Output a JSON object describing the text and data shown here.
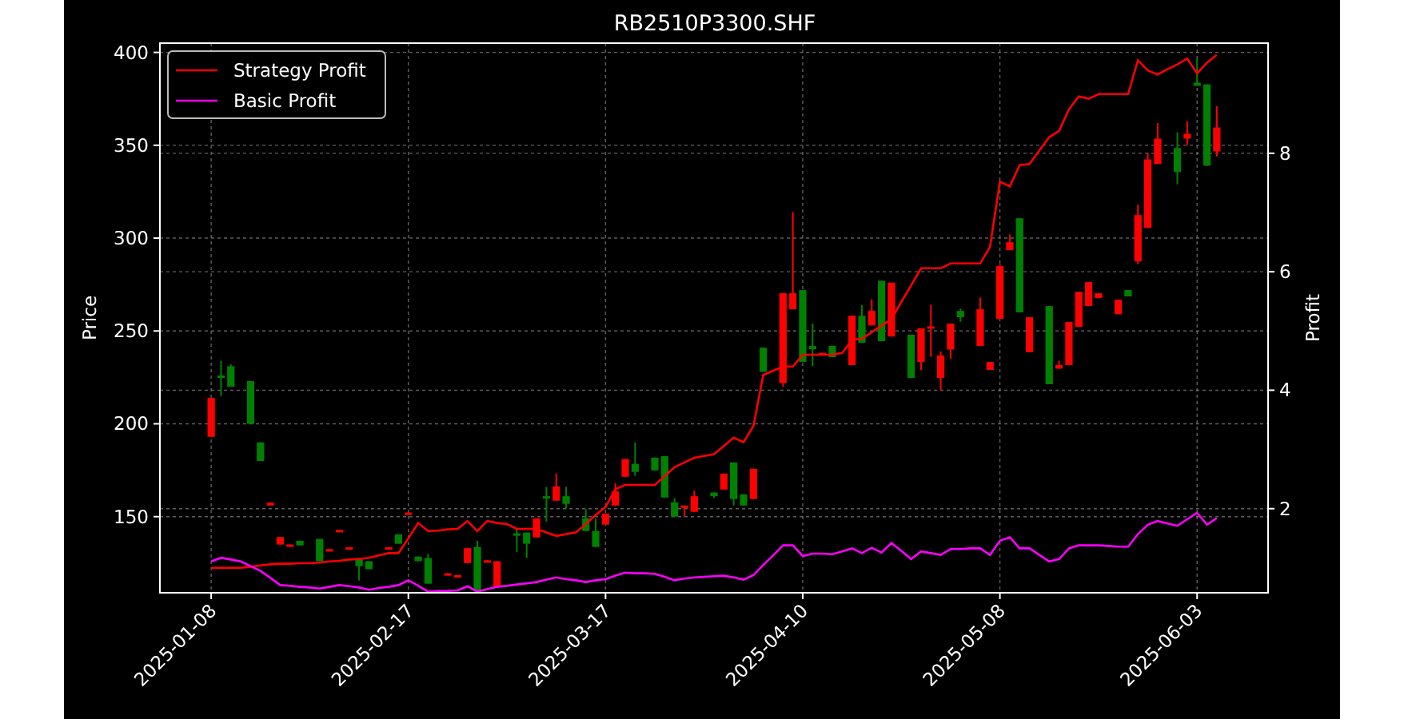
{
  "price_chart": {
    "chart_data": {
      "type": "candlestick",
      "title": "RB2510P3300.SHF",
      "ylabel": "Price",
      "grid": true,
      "ylim": [
        109,
        405
      ],
      "categories": [
        "2025-01-08",
        null,
        null,
        null,
        null,
        null,
        null,
        null,
        null,
        null,
        null,
        null,
        null,
        null,
        null,
        null,
        null,
        null,
        null,
        null,
        "2025-02-17",
        null,
        null,
        null,
        null,
        null,
        null,
        null,
        null,
        null,
        null,
        null,
        null,
        null,
        null,
        null,
        null,
        null,
        null,
        null,
        "2025-03-17",
        null,
        null,
        null,
        null,
        null,
        null,
        null,
        null,
        null,
        null,
        null,
        null,
        null,
        null,
        null,
        null,
        null,
        null,
        null,
        "2025-04-10",
        null,
        null,
        null,
        null,
        null,
        null,
        null,
        null,
        null,
        null,
        null,
        null,
        null,
        null,
        null,
        null,
        null,
        null,
        null,
        "2025-05-08",
        null,
        null,
        null,
        null,
        null,
        null,
        null,
        null,
        null,
        null,
        null,
        null,
        null,
        null,
        null,
        null,
        null,
        null,
        null,
        "2025-06-03",
        null,
        null
      ],
      "yticks": [
        {
          "value": 150,
          "label": "150"
        },
        {
          "value": 200,
          "label": "200"
        },
        {
          "value": 250,
          "label": "250"
        },
        {
          "value": 300,
          "label": "300"
        },
        {
          "value": 350,
          "label": "350"
        },
        {
          "value": 400,
          "label": "400"
        }
      ],
      "ohlc": [
        [
          193,
          214,
          193,
          214
        ],
        [
          226,
          234,
          215,
          225
        ],
        [
          231,
          232,
          220,
          220
        ],
        null,
        [
          223,
          223,
          200,
          200
        ],
        [
          190,
          190,
          180,
          180
        ],
        [
          156,
          157.5,
          156,
          157.5
        ],
        [
          135,
          139,
          135,
          139
        ],
        [
          134,
          135,
          134,
          135
        ],
        [
          137,
          137,
          134.5,
          134.5
        ],
        null,
        [
          138,
          138,
          126,
          126
        ],
        [
          131.5,
          132.5,
          131.5,
          132.5
        ],
        [
          141.8,
          142.8,
          141.8,
          142.8
        ],
        [
          132.5,
          133.5,
          132.5,
          133.5
        ],
        [
          127.7,
          127.7,
          115.6,
          123.4
        ],
        [
          126,
          126,
          121.7,
          121.7
        ],
        null,
        [
          132.5,
          133.5,
          132.5,
          133.5
        ],
        [
          140.5,
          140.5,
          135.4,
          135.4
        ],
        [
          151.2,
          152.2,
          151.2,
          152.2
        ],
        [
          128.5,
          128.5,
          126,
          126
        ],
        [
          127.7,
          130,
          113.9,
          113.9
        ],
        null,
        [
          118.5,
          119.5,
          118.5,
          119.5
        ],
        [
          117.5,
          118.5,
          117.5,
          118.5
        ],
        [
          125,
          133,
          125,
          133
        ],
        [
          133.7,
          137,
          109.6,
          109.6
        ],
        [
          125.5,
          126.5,
          125.5,
          126.5
        ],
        [
          112.2,
          126,
          112.2,
          126
        ],
        null,
        [
          141,
          143.8,
          131,
          140
        ],
        [
          141.4,
          141.4,
          127.7,
          135.4
        ],
        [
          138.8,
          149.1,
          138.8,
          149.1
        ],
        [
          161,
          166,
          147.4,
          160
        ],
        [
          158.6,
          173.2,
          158.6,
          166.3
        ],
        [
          161,
          166,
          154.3,
          156.9
        ],
        null,
        [
          149.1,
          154,
          142.3,
          142.3
        ],
        [
          142.3,
          149,
          133.7,
          133.7
        ],
        [
          145.7,
          151.7,
          145.7,
          151.7
        ],
        [
          156,
          168,
          156,
          163.7
        ],
        [
          171.5,
          181,
          171.5,
          181
        ],
        [
          178.4,
          190,
          172,
          174.1
        ],
        null,
        [
          181.8,
          181.8,
          174.9,
          174.9
        ],
        [
          182.6,
          182.6,
          160.3,
          160.3
        ],
        [
          157.7,
          160,
          150,
          150
        ],
        [
          155,
          156,
          150,
          156
        ],
        [
          152.6,
          164,
          152.6,
          161
        ],
        null,
        [
          163,
          163,
          160,
          161
        ],
        [
          164.6,
          173.2,
          164.6,
          173.2
        ],
        [
          179.2,
          179.2,
          156,
          159.5
        ],
        [
          162,
          162,
          156,
          156
        ],
        [
          159.5,
          175.8,
          159.5,
          175.8
        ],
        [
          241,
          241,
          228,
          228
        ],
        null,
        [
          222,
          270.3,
          220,
          270.3
        ],
        [
          261.7,
          314,
          261.7,
          270.3
        ],
        [
          272,
          272,
          233.3,
          233.3
        ],
        [
          241.9,
          254,
          231,
          240.2
        ],
        [
          237,
          238.2,
          237,
          238.2
        ],
        [
          242,
          242,
          235.9,
          235.9
        ],
        null,
        [
          231.6,
          258.2,
          231.6,
          258.2
        ],
        [
          258.2,
          264,
          243.6,
          243.6
        ],
        [
          253,
          267,
          253,
          260.8
        ],
        [
          277,
          277,
          244.5,
          244.5
        ],
        [
          247,
          276,
          247,
          276
        ],
        null,
        [
          248,
          248,
          224.7,
          224.7
        ],
        [
          233.3,
          251.4,
          229,
          251.4
        ],
        [
          251.5,
          264,
          236,
          252.5
        ],
        [
          224.7,
          239,
          218,
          236.8
        ],
        [
          240,
          254,
          235,
          254
        ],
        [
          260.8,
          262,
          255,
          257.4
        ],
        null,
        [
          241.9,
          268,
          241.9,
          261.7
        ],
        [
          229,
          233.3,
          229,
          233.3
        ],
        [
          256.5,
          286,
          256.5,
          284.9
        ],
        [
          293.5,
          302,
          293.5,
          297.8
        ],
        [
          310.7,
          310.7,
          260,
          260
        ],
        [
          238.5,
          257.4,
          238.5,
          257.4
        ],
        null,
        [
          263.4,
          263.4,
          221.3,
          221.3
        ],
        [
          229.7,
          234,
          229.7,
          231.6
        ],
        [
          231.6,
          254.8,
          231.6,
          254.8
        ],
        [
          252.2,
          271.1,
          252.2,
          271.1
        ],
        [
          263.4,
          276.3,
          263.4,
          276.3
        ],
        [
          267.7,
          270.3,
          267.7,
          270.3
        ],
        null,
        [
          259,
          266.8,
          259,
          266.8
        ],
        [
          272,
          272,
          268.6,
          268.6
        ],
        [
          287.5,
          318,
          286,
          312.4
        ],
        [
          305.5,
          346,
          305.5,
          342.4
        ],
        [
          339.9,
          362,
          339.9,
          353.6
        ],
        null,
        [
          348.5,
          357,
          329,
          335.6
        ],
        [
          353.6,
          363,
          350,
          356.2
        ],
        [
          383.7,
          397,
          382,
          382
        ],
        [
          382.8,
          382.8,
          339,
          339
        ],
        [
          346.7,
          371,
          344,
          359.6
        ]
      ]
    }
  },
  "profit_chart": {
    "chart_data": {
      "type": "line",
      "ylabel": "Profit",
      "legend": "upper left",
      "ylim": [
        0.58,
        9.86
      ],
      "categories": [
        null,
        null,
        null,
        null,
        null,
        null,
        null,
        null,
        null,
        null,
        null,
        null,
        null,
        null,
        null,
        null,
        null,
        null,
        null,
        null,
        null,
        null,
        null,
        null,
        null,
        null,
        null,
        null,
        null,
        null,
        null,
        null,
        null,
        null,
        null,
        null,
        null,
        null,
        null,
        null,
        null,
        null,
        null,
        null,
        null,
        null,
        null,
        null,
        null,
        null,
        null,
        null,
        null,
        null,
        null,
        null,
        null,
        null,
        null,
        null,
        null,
        null,
        null,
        null,
        null,
        null,
        null,
        null,
        null,
        null,
        null,
        null,
        null,
        null,
        null,
        null,
        null,
        null,
        null,
        null,
        null,
        null,
        null,
        null,
        null,
        null,
        null,
        null,
        null,
        null,
        null,
        null,
        null,
        null,
        null,
        null,
        null,
        null,
        null,
        null,
        null,
        null,
        null
      ],
      "yticks": [
        {
          "value": 2,
          "label": "2"
        },
        {
          "value": 4,
          "label": "4"
        },
        {
          "value": 6,
          "label": "6"
        },
        {
          "value": 8,
          "label": "8"
        }
      ],
      "series": [
        {
          "name": "Strategy Profit",
          "color": "#ff0000",
          "values": [
            1.0,
            1.0,
            1.0,
            1.0,
            1.02,
            1.04,
            1.06,
            1.07,
            1.07,
            1.08,
            1.08,
            1.09,
            1.11,
            1.12,
            1.14,
            1.15,
            1.17,
            1.21,
            1.25,
            1.25,
            1.5,
            1.76,
            1.62,
            1.63,
            1.65,
            1.66,
            1.79,
            1.62,
            1.79,
            1.76,
            1.74,
            1.66,
            1.66,
            1.66,
            1.6,
            1.54,
            1.57,
            1.6,
            1.74,
            1.89,
            2.03,
            2.33,
            2.4,
            2.4,
            2.4,
            2.4,
            2.55,
            2.7,
            2.78,
            2.86,
            2.89,
            2.92,
            3.06,
            3.2,
            3.12,
            3.4,
            4.26,
            4.33,
            4.4,
            4.4,
            4.6,
            4.6,
            4.6,
            4.6,
            4.63,
            4.85,
            4.87,
            4.98,
            5.09,
            5.2,
            5.49,
            5.77,
            6.06,
            6.06,
            6.06,
            6.14,
            6.14,
            6.14,
            6.14,
            6.42,
            7.52,
            7.44,
            7.8,
            7.82,
            8.05,
            8.27,
            8.38,
            8.74,
            8.96,
            8.92,
            9.0,
            9.0,
            9.0,
            9.0,
            9.57,
            9.4,
            9.33,
            9.42,
            9.5,
            9.6,
            9.35,
            9.53,
            9.66
          ]
        },
        {
          "name": "Basic Profit",
          "color": "#ff00ff",
          "values": [
            1.11,
            1.17,
            1.14,
            1.11,
            1.03,
            0.95,
            0.83,
            0.71,
            0.7,
            0.68,
            0.67,
            0.65,
            0.68,
            0.71,
            0.69,
            0.67,
            0.63,
            0.66,
            0.68,
            0.71,
            0.79,
            0.7,
            0.6,
            0.61,
            0.61,
            0.62,
            0.69,
            0.6,
            0.64,
            0.68,
            0.7,
            0.72,
            0.74,
            0.76,
            0.8,
            0.84,
            0.81,
            0.79,
            0.76,
            0.79,
            0.81,
            0.87,
            0.92,
            0.91,
            0.91,
            0.9,
            0.85,
            0.79,
            0.82,
            0.84,
            0.85,
            0.86,
            0.87,
            0.84,
            0.8,
            0.88,
            1.05,
            1.21,
            1.38,
            1.38,
            1.2,
            1.24,
            1.24,
            1.23,
            1.28,
            1.33,
            1.25,
            1.34,
            1.26,
            1.42,
            1.29,
            1.15,
            1.28,
            1.25,
            1.22,
            1.32,
            1.32,
            1.33,
            1.33,
            1.22,
            1.46,
            1.52,
            1.33,
            1.33,
            1.22,
            1.11,
            1.15,
            1.33,
            1.38,
            1.38,
            1.38,
            1.37,
            1.36,
            1.36,
            1.57,
            1.73,
            1.79,
            1.75,
            1.71,
            1.82,
            1.93,
            1.73,
            1.84
          ]
        }
      ]
    }
  }
}
